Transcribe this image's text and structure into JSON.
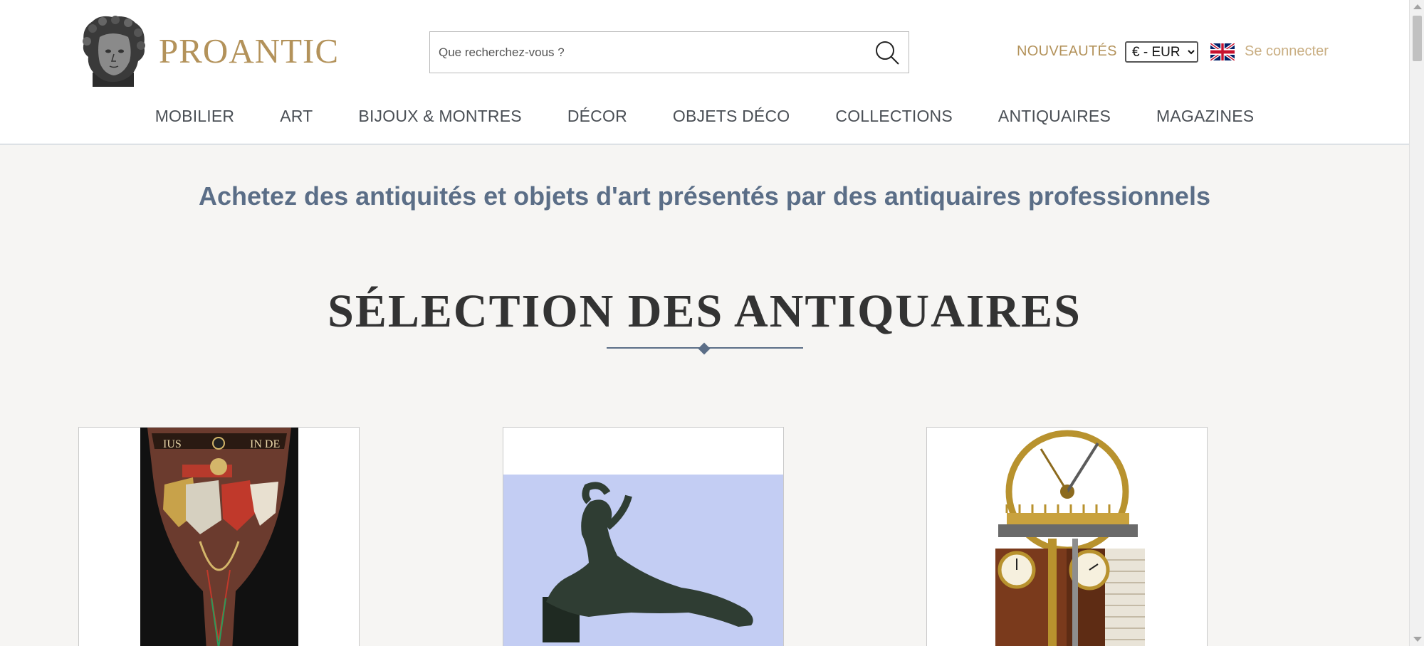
{
  "header": {
    "brand": "PROANTIC",
    "search": {
      "placeholder": "Que recherchez-vous ?"
    },
    "nouveautes": "NOUVEAUTÉS",
    "currency": {
      "selected": "€ - EUR"
    },
    "language_flag": "uk-flag-icon",
    "login": "Se connecter"
  },
  "nav": {
    "items": [
      {
        "label": "MOBILIER"
      },
      {
        "label": "ART"
      },
      {
        "label": "BIJOUX & MONTRES"
      },
      {
        "label": "DÉCOR"
      },
      {
        "label": "OBJETS DÉCO"
      },
      {
        "label": "COLLECTIONS"
      },
      {
        "label": "ANTIQUAIRES"
      },
      {
        "label": "MAGAZINES"
      }
    ]
  },
  "main": {
    "tagline": "Achetez des antiquités et objets d'art présentés par des antiquaires professionnels",
    "section_title": "SÉLECTION DES ANTIQUAIRES",
    "cards": [
      {
        "image": "enameled-glass-goblet"
      },
      {
        "image": "reclining-nude-bronze-sculpture"
      },
      {
        "image": "steam-engine-clock"
      }
    ]
  },
  "colors": {
    "brand_gold": "#b3925a",
    "link_light_gold": "#c9ae82",
    "tagline_blue": "#5b6e87",
    "background": "#f6f5f3"
  }
}
